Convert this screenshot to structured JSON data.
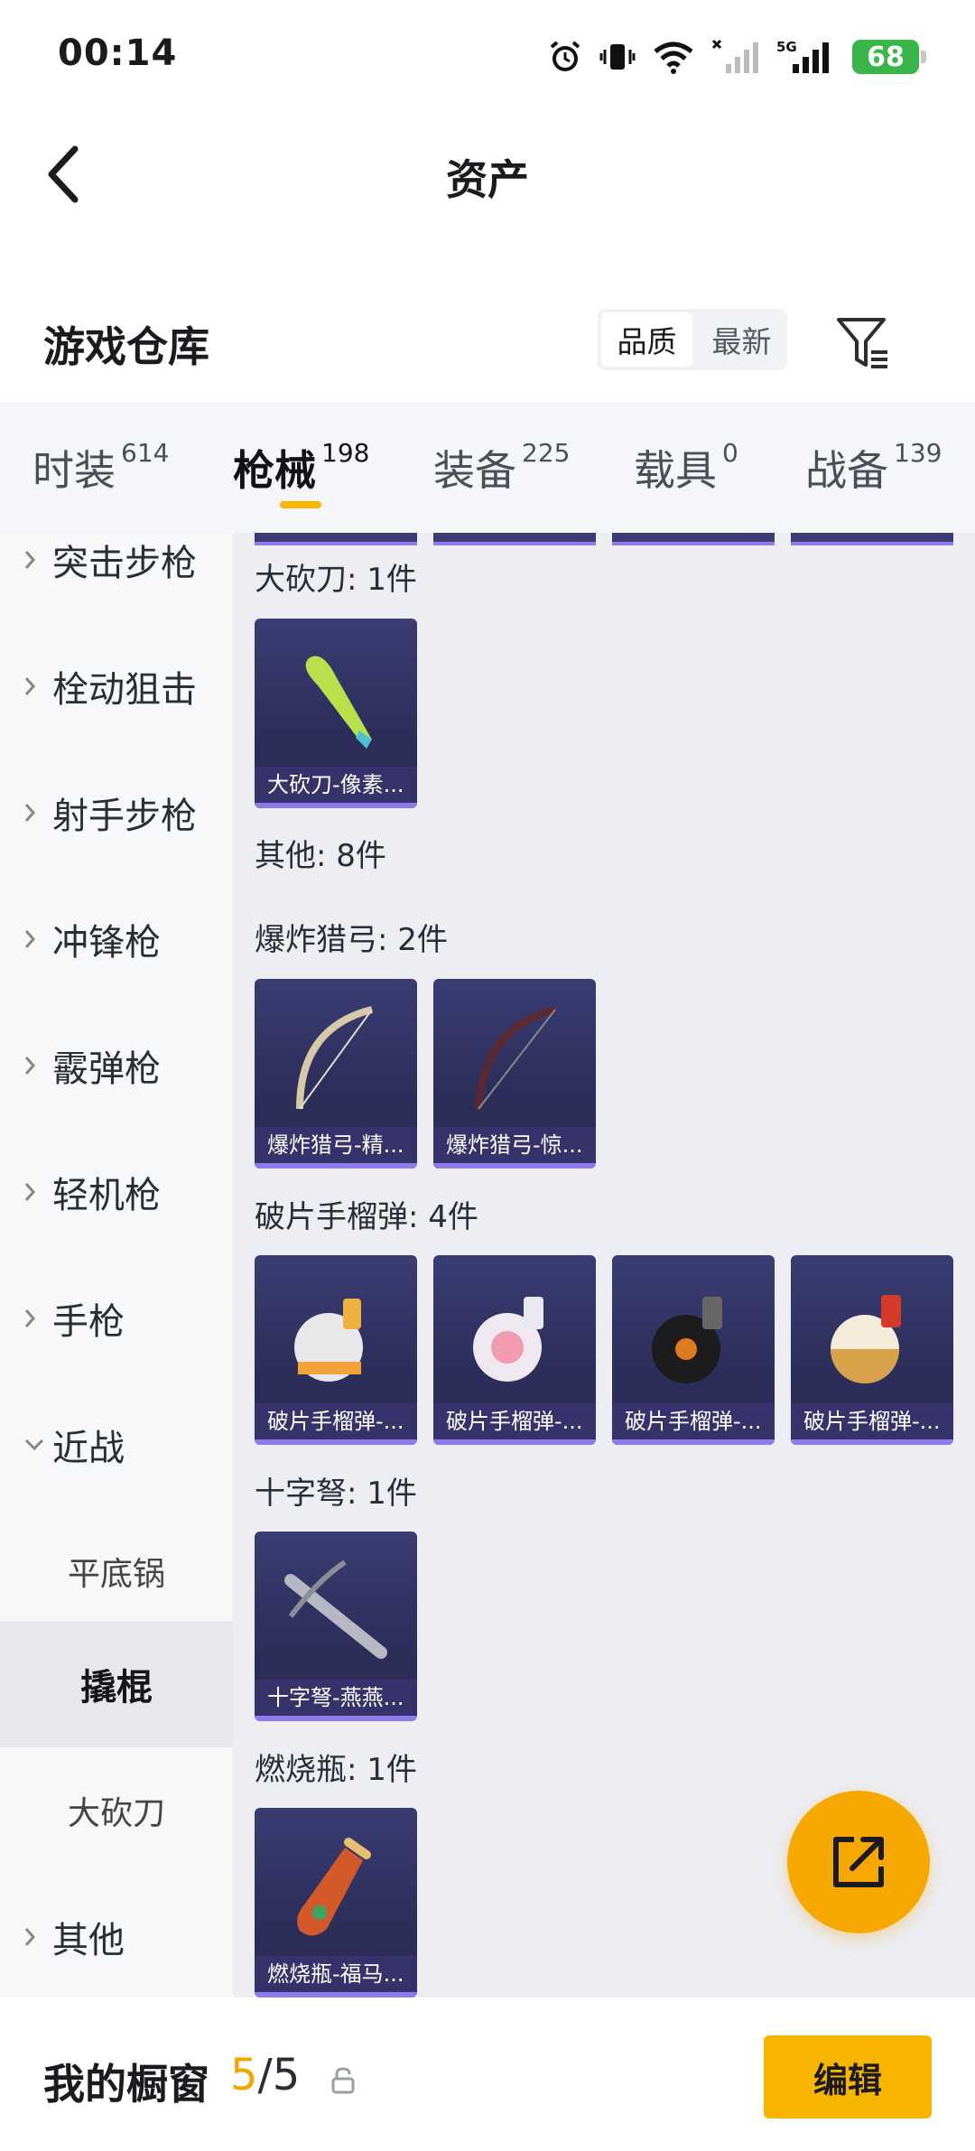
{
  "status_bar": {
    "time": "00:14",
    "battery": "68",
    "network_label": "5G"
  },
  "header": {
    "title": "资产"
  },
  "warehouse": {
    "title": "游戏仓库",
    "sort_options": [
      "品质",
      "最新"
    ]
  },
  "tabs": [
    {
      "label": "时装",
      "count": "614"
    },
    {
      "label": "枪械",
      "count": "198"
    },
    {
      "label": "装备",
      "count": "225"
    },
    {
      "label": "载具",
      "count": "0"
    },
    {
      "label": "战备",
      "count": "139"
    }
  ],
  "sidebar": {
    "categories": [
      "突击步枪",
      "栓动狙击",
      "射手步枪",
      "冲锋枪",
      "霰弹枪",
      "轻机枪",
      "手枪",
      "近战"
    ],
    "subcategories": [
      "平底锅",
      "撬棍",
      "大砍刀"
    ],
    "last": "其他"
  },
  "content": {
    "groups": [
      {
        "title": "大砍刀: 1件",
        "items": [
          "大砍刀-像素..."
        ]
      },
      {
        "title": "其他: 8件",
        "items": []
      },
      {
        "title": "爆炸猎弓: 2件",
        "items": [
          "爆炸猎弓-精...",
          "爆炸猎弓-惊..."
        ]
      },
      {
        "title": "破片手榴弹: 4件",
        "items": [
          "破片手榴弹-...",
          "破片手榴弹-...",
          "破片手榴弹-...",
          "破片手榴弹-..."
        ]
      },
      {
        "title": "十字弩: 1件",
        "items": [
          "十字弩-燕燕..."
        ]
      },
      {
        "title": "燃烧瓶: 1件",
        "items": [
          "燃烧瓶-福马..."
        ]
      }
    ]
  },
  "bottom_bar": {
    "label": "我的橱窗",
    "used": "5",
    "separator": "/",
    "total": "5",
    "edit_label": "编辑"
  },
  "colors": {
    "accent": "#f7b500",
    "card_bg": "#2d2f5c",
    "card_stripe": "#8e7ae8",
    "content_bg": "#eceef3"
  }
}
